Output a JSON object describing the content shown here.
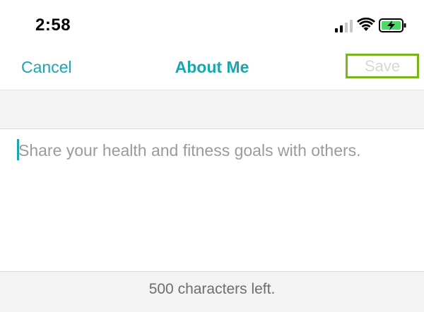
{
  "status_bar": {
    "time": "2:58"
  },
  "nav": {
    "cancel_label": "Cancel",
    "title": "About Me",
    "save_label": "Save"
  },
  "editor": {
    "placeholder": "Share your health and fitness goals with others."
  },
  "footer": {
    "characters_left": "500 characters left."
  },
  "colors": {
    "accent": "#1aa6b0",
    "highlight_border": "#7ab51d",
    "battery_fill": "#4cd964",
    "disabled_text": "#d7d7d7"
  },
  "icons": [
    "signal-icon",
    "wifi-icon",
    "battery-charging-icon"
  ]
}
